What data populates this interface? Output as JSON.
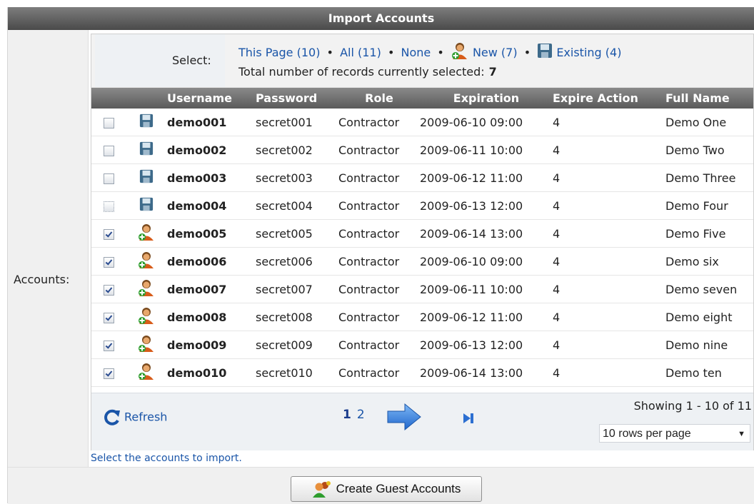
{
  "title": "Import Accounts",
  "accounts_label": "Accounts:",
  "select": {
    "label": "Select:",
    "this_page": "This Page (10)",
    "all": "All (11)",
    "none": "None",
    "new": "New (7)",
    "existing": "Existing (4)",
    "separator": "•",
    "total_label": "Total number of records currently selected:",
    "total_value": "7"
  },
  "columns": [
    "Username",
    "Password",
    "Role",
    "Expiration",
    "Expire Action",
    "Full Name"
  ],
  "rows": [
    {
      "checked": false,
      "status": "existing",
      "icon": "floppy-disk-icon",
      "username": "demo001",
      "password": "secret001",
      "role": "Contractor",
      "expiration": "2009-06-10 09:00",
      "expire_action": "4",
      "full_name": "Demo One"
    },
    {
      "checked": false,
      "status": "existing",
      "icon": "floppy-disk-icon",
      "username": "demo002",
      "password": "secret002",
      "role": "Contractor",
      "expiration": "2009-06-11 10:00",
      "expire_action": "4",
      "full_name": "Demo Two"
    },
    {
      "checked": false,
      "status": "existing",
      "icon": "floppy-disk-icon",
      "username": "demo003",
      "password": "secret003",
      "role": "Contractor",
      "expiration": "2009-06-12 11:00",
      "expire_action": "4",
      "full_name": "Demo Three"
    },
    {
      "checked": false,
      "status": "existing",
      "icon": "floppy-disk-icon",
      "username": "demo004",
      "password": "secret004",
      "role": "Contractor",
      "expiration": "2009-06-13 12:00",
      "expire_action": "4",
      "full_name": "Demo Four"
    },
    {
      "checked": true,
      "status": "new",
      "icon": "new-user-icon",
      "username": "demo005",
      "password": "secret005",
      "role": "Contractor",
      "expiration": "2009-06-14 13:00",
      "expire_action": "4",
      "full_name": "Demo Five"
    },
    {
      "checked": true,
      "status": "new",
      "icon": "new-user-icon",
      "username": "demo006",
      "password": "secret006",
      "role": "Contractor",
      "expiration": "2009-06-10 09:00",
      "expire_action": "4",
      "full_name": "Demo six"
    },
    {
      "checked": true,
      "status": "new",
      "icon": "new-user-icon",
      "username": "demo007",
      "password": "secret007",
      "role": "Contractor",
      "expiration": "2009-06-11 10:00",
      "expire_action": "4",
      "full_name": "Demo seven"
    },
    {
      "checked": true,
      "status": "new",
      "icon": "new-user-icon",
      "username": "demo008",
      "password": "secret008",
      "role": "Contractor",
      "expiration": "2009-06-12 11:00",
      "expire_action": "4",
      "full_name": "Demo eight"
    },
    {
      "checked": true,
      "status": "new",
      "icon": "new-user-icon",
      "username": "demo009",
      "password": "secret009",
      "role": "Contractor",
      "expiration": "2009-06-13 12:00",
      "expire_action": "4",
      "full_name": "Demo nine"
    },
    {
      "checked": true,
      "status": "new",
      "icon": "new-user-icon",
      "username": "demo010",
      "password": "secret010",
      "role": "Contractor",
      "expiration": "2009-06-14 13:00",
      "expire_action": "4",
      "full_name": "Demo ten"
    }
  ],
  "pager": {
    "refresh": "Refresh",
    "current_page": "1",
    "other_page": "2",
    "showing": "Showing 1 - 10 of 11",
    "rows_per_page": "10 rows per page"
  },
  "hint": "Select the accounts to import.",
  "create_button": "Create Guest Accounts",
  "colors": {
    "link": "#1a55a8",
    "header_bg": "#5a5a5a",
    "panel_bg": "#eef1f4"
  }
}
